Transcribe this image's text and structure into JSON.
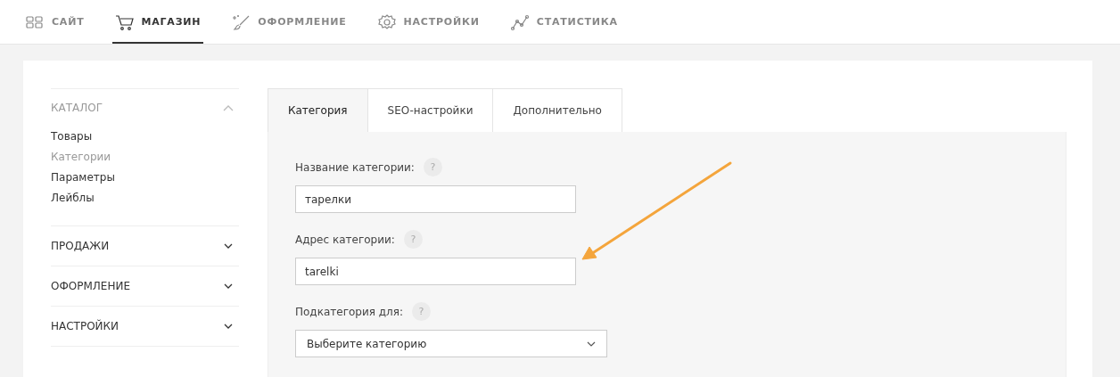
{
  "top_nav": [
    {
      "label": "САЙТ",
      "selected": false
    },
    {
      "label": "МАГАЗИН",
      "selected": true
    },
    {
      "label": "ОФОРМЛЕНИЕ",
      "selected": false
    },
    {
      "label": "НАСТРОЙКИ",
      "selected": false
    },
    {
      "label": "СТАТИСТИКА",
      "selected": false
    }
  ],
  "sidebar": {
    "sections": [
      {
        "title": "КАТАЛОГ",
        "expanded": true,
        "items": [
          {
            "label": "Товары",
            "selected": false
          },
          {
            "label": "Категории",
            "selected": true
          },
          {
            "label": "Параметры",
            "selected": false
          },
          {
            "label": "Лейблы",
            "selected": false
          }
        ]
      },
      {
        "title": "ПРОДАЖИ",
        "expanded": false
      },
      {
        "title": "ОФОРМЛЕНИЕ",
        "expanded": false
      },
      {
        "title": "НАСТРОЙКИ",
        "expanded": false
      }
    ]
  },
  "tabs": [
    {
      "label": "Категория",
      "selected": true
    },
    {
      "label": "SEO-настройки",
      "selected": false
    },
    {
      "label": "Дополнительно",
      "selected": false
    }
  ],
  "form": {
    "fields": [
      {
        "kind": "text",
        "label": "Название категории:",
        "help": "?",
        "value": "тарелки"
      },
      {
        "kind": "text",
        "label": "Адрес категории:",
        "help": "?",
        "value": "tarelki"
      },
      {
        "kind": "select",
        "label": "Подкатегория для:",
        "help": "?",
        "value": "Выберите категорию"
      }
    ]
  }
}
